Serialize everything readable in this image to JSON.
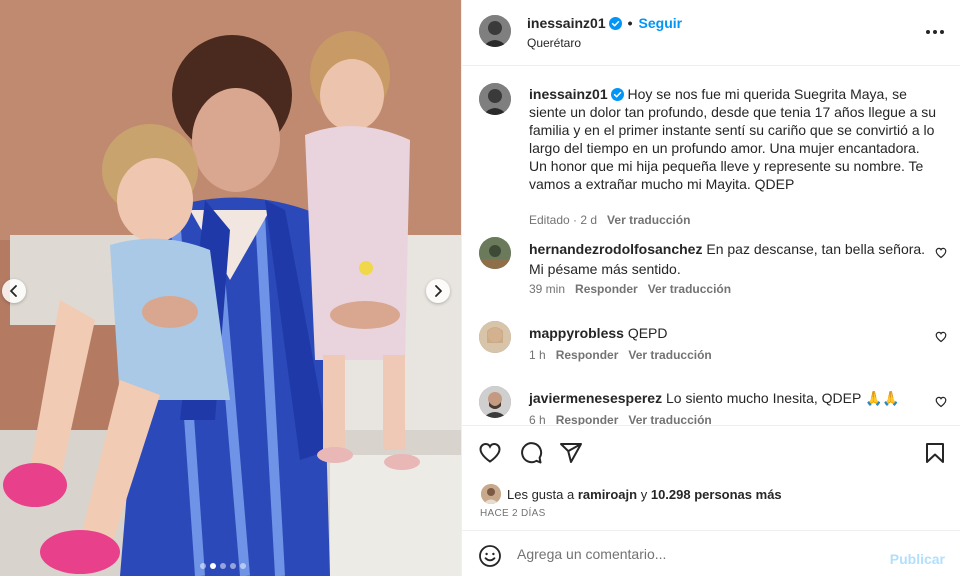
{
  "post": {
    "username": "inessainz01",
    "follow_label": "Seguir",
    "separator": "•",
    "location": "Querétaro",
    "verified_icon": "verified-badge-icon",
    "more_icon": "more-options-icon"
  },
  "caption": {
    "username": "inessainz01",
    "text": "Hoy se nos fue mi querida Suegrita Maya, se siente un dolor tan profundo, desde que tenia 17 años llegue a su familia y en el primer instante sentí su cariño que se convirtió a lo largo del tiempo en un profundo amor. Una mujer encantadora. Un honor que mi hija pequeña lleve y represente su nombre. Te vamos a extrañar mucho mi Mayita. QDEP",
    "edited": "Editado · 2 d",
    "see_translation": "Ver traducción"
  },
  "comments": [
    {
      "username": "hernandezrodolfosanchez",
      "text": "En paz descanse, tan bella señora. Mi pésame más sentido.",
      "time": "39 min",
      "reply": "Responder",
      "see_translation": "Ver traducción"
    },
    {
      "username": "mappyrobless",
      "text": "QEPD",
      "time": "1 h",
      "reply": "Responder",
      "see_translation": "Ver traducción"
    },
    {
      "username": "javiermenesesperez",
      "text": "Lo siento mucho Inesita, QDEP 🙏🙏",
      "time": "6 h",
      "reply": "Responder",
      "see_translation": "Ver traducción"
    }
  ],
  "likes": {
    "prefix": "Les gusta a",
    "user": "ramiroajn",
    "connector": "y",
    "others": "10.298 personas más"
  },
  "date": "HACE 2 DÍAS",
  "add_comment": {
    "placeholder": "Agrega un comentario...",
    "post_label": "Publicar"
  },
  "carousel": {
    "slide_count": 5,
    "active_index": 1
  },
  "colors": {
    "accent": "#0095f6",
    "text": "#262626",
    "secondary": "#737373",
    "post_disabled": "#b2dffc"
  }
}
